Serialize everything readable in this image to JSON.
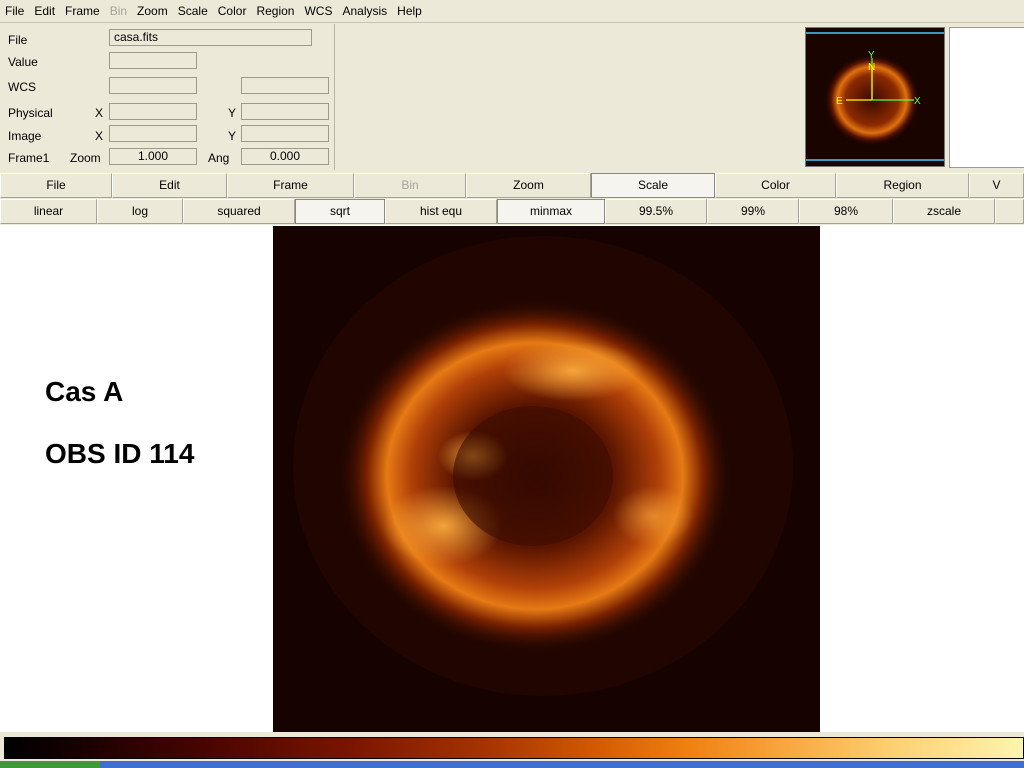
{
  "menu": [
    {
      "label": "File",
      "disabled": false
    },
    {
      "label": "Edit",
      "disabled": false
    },
    {
      "label": "Frame",
      "disabled": false
    },
    {
      "label": "Bin",
      "disabled": true
    },
    {
      "label": "Zoom",
      "disabled": false
    },
    {
      "label": "Scale",
      "disabled": false
    },
    {
      "label": "Color",
      "disabled": false
    },
    {
      "label": "Region",
      "disabled": false
    },
    {
      "label": "WCS",
      "disabled": false
    },
    {
      "label": "Analysis",
      "disabled": false
    },
    {
      "label": "Help",
      "disabled": false
    }
  ],
  "info": {
    "file_label": "File",
    "file_value": "casa.fits",
    "value_label": "Value",
    "wcs_label": "WCS",
    "physical_label": "Physical",
    "image_label": "Image",
    "x_label": "X",
    "y_label": "Y",
    "frame_label": "Frame1",
    "zoom_label": "Zoom",
    "zoom_value": "1.000",
    "ang_label": "Ang",
    "ang_value": "0.000"
  },
  "compass": {
    "north": "N",
    "east": "E",
    "x": "X",
    "y": "Y"
  },
  "buttons_row1": [
    {
      "label": "File",
      "selected": false,
      "disabled": false
    },
    {
      "label": "Edit",
      "selected": false,
      "disabled": false
    },
    {
      "label": "Frame",
      "selected": false,
      "disabled": false
    },
    {
      "label": "Bin",
      "selected": false,
      "disabled": true
    },
    {
      "label": "Zoom",
      "selected": false,
      "disabled": false
    },
    {
      "label": "Scale",
      "selected": true,
      "disabled": false
    },
    {
      "label": "Color",
      "selected": false,
      "disabled": false
    },
    {
      "label": "Region",
      "selected": false,
      "disabled": false
    },
    {
      "label": "V",
      "selected": false,
      "disabled": false
    }
  ],
  "buttons_row2": [
    {
      "label": "linear",
      "selected": false
    },
    {
      "label": "log",
      "selected": false
    },
    {
      "label": "squared",
      "selected": false
    },
    {
      "label": "sqrt",
      "selected": true
    },
    {
      "label": "hist equ",
      "selected": false
    },
    {
      "label": "minmax",
      "selected": true
    },
    {
      "label": "99.5%",
      "selected": false
    },
    {
      "label": "99%",
      "selected": false
    },
    {
      "label": "98%",
      "selected": false
    },
    {
      "label": "zscale",
      "selected": false
    },
    {
      "label": "",
      "selected": false
    }
  ],
  "caption": {
    "line1": "Cas A",
    "line2": "OBS ID 114"
  },
  "colors": {
    "image_bg": "#160300",
    "accent_orange": "#f08010",
    "compass_green": "#5cff3c",
    "compass_yellow": "#ffff00"
  }
}
